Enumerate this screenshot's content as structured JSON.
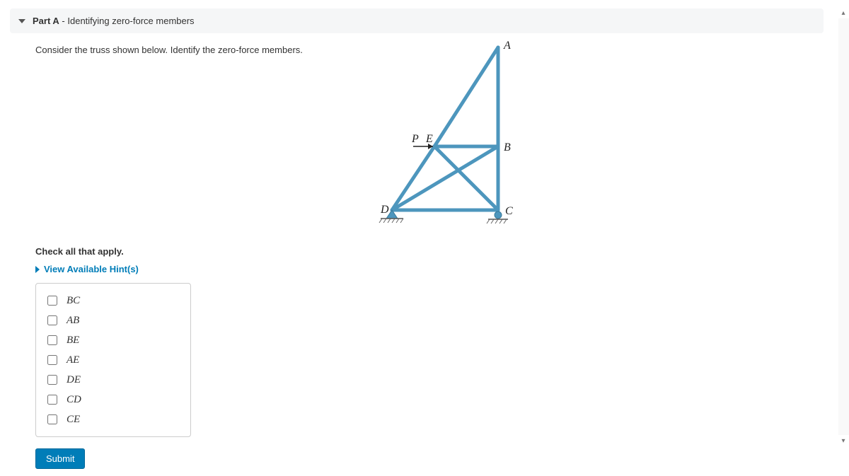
{
  "part": {
    "label": "Part A",
    "separator": " - ",
    "title": "Identifying zero-force members",
    "prompt": "Consider the truss shown below. Identify the zero-force members."
  },
  "figure": {
    "force_label": "P",
    "nodes": {
      "A": "A",
      "B": "B",
      "C": "C",
      "D": "D",
      "E": "E"
    }
  },
  "answers": {
    "check_title": "Check all that apply.",
    "hints_label": "View Available Hint(s)",
    "options": [
      "BC",
      "AB",
      "BE",
      "AE",
      "DE",
      "CD",
      "CE"
    ]
  },
  "submit_label": "Submit"
}
